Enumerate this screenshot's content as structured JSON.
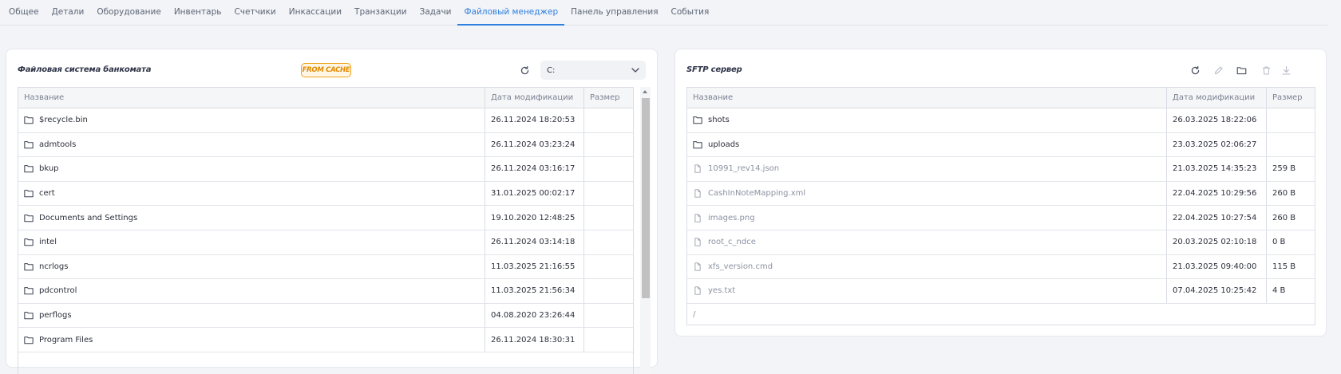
{
  "tabs": [
    {
      "label": "Общее",
      "active": false
    },
    {
      "label": "Детали",
      "active": false
    },
    {
      "label": "Оборудование",
      "active": false
    },
    {
      "label": "Инвентарь",
      "active": false
    },
    {
      "label": "Счетчики",
      "active": false
    },
    {
      "label": "Инкассации",
      "active": false
    },
    {
      "label": "Транзакции",
      "active": false
    },
    {
      "label": "Задачи",
      "active": false
    },
    {
      "label": "Файловый менеджер",
      "active": true
    },
    {
      "label": "Панель управления",
      "active": false
    },
    {
      "label": "События",
      "active": false
    }
  ],
  "left_panel": {
    "title": "Файловая система банкомата",
    "badge": "FROM CACHE",
    "drive": "C:",
    "columns": {
      "name": "Название",
      "date": "Дата модификации",
      "size": "Размер"
    },
    "rows": [
      {
        "type": "folder",
        "name": "$recycle.bin",
        "date": "26.11.2024 18:20:53",
        "size": ""
      },
      {
        "type": "folder",
        "name": "admtools",
        "date": "26.11.2024 03:23:24",
        "size": ""
      },
      {
        "type": "folder",
        "name": "bkup",
        "date": "26.11.2024 03:16:17",
        "size": ""
      },
      {
        "type": "folder",
        "name": "cert",
        "date": "31.01.2025 00:02:17",
        "size": ""
      },
      {
        "type": "folder",
        "name": "Documents and Settings",
        "date": "19.10.2020 12:48:25",
        "size": ""
      },
      {
        "type": "folder",
        "name": "intel",
        "date": "26.11.2024 03:14:18",
        "size": ""
      },
      {
        "type": "folder",
        "name": "ncrlogs",
        "date": "11.03.2025 21:16:55",
        "size": ""
      },
      {
        "type": "folder",
        "name": "pdcontrol",
        "date": "11.03.2025 21:56:34",
        "size": ""
      },
      {
        "type": "folder",
        "name": "perflogs",
        "date": "04.08.2020 23:26:44",
        "size": ""
      },
      {
        "type": "folder",
        "name": "Program Files",
        "date": "26.11.2024 18:30:31",
        "size": ""
      }
    ]
  },
  "right_panel": {
    "title": "SFTP сервер",
    "columns": {
      "name": "Название",
      "date": "Дата модификации",
      "size": "Размер"
    },
    "rows": [
      {
        "type": "folder",
        "name": "shots",
        "date": "26.03.2025 18:22:06",
        "size": ""
      },
      {
        "type": "folder",
        "name": "uploads",
        "date": "23.03.2025 02:06:27",
        "size": ""
      },
      {
        "type": "file",
        "name": "10991_rev14.json",
        "date": "21.03.2025 14:35:23",
        "size": "259 B"
      },
      {
        "type": "file",
        "name": "CashInNoteMapping.xml",
        "date": "22.04.2025 10:29:56",
        "size": "260 B"
      },
      {
        "type": "file",
        "name": "images.png",
        "date": "22.04.2025 10:27:54",
        "size": "260 B"
      },
      {
        "type": "file",
        "name": "root_c_ndce",
        "date": "20.03.2025 02:10:18",
        "size": "0 B"
      },
      {
        "type": "file",
        "name": "xfs_version.cmd",
        "date": "21.03.2025 09:40:00",
        "size": "115 B"
      },
      {
        "type": "file",
        "name": "yes.txt",
        "date": "07.04.2025 10:25:42",
        "size": "4 B"
      }
    ],
    "path": "/"
  },
  "icons": {
    "refresh": "refresh-icon",
    "edit": "pencil-icon",
    "folder": "folder-icon",
    "file": "file-icon",
    "delete": "trash-icon",
    "download": "download-icon",
    "dropdown": "chevron-down-icon"
  }
}
